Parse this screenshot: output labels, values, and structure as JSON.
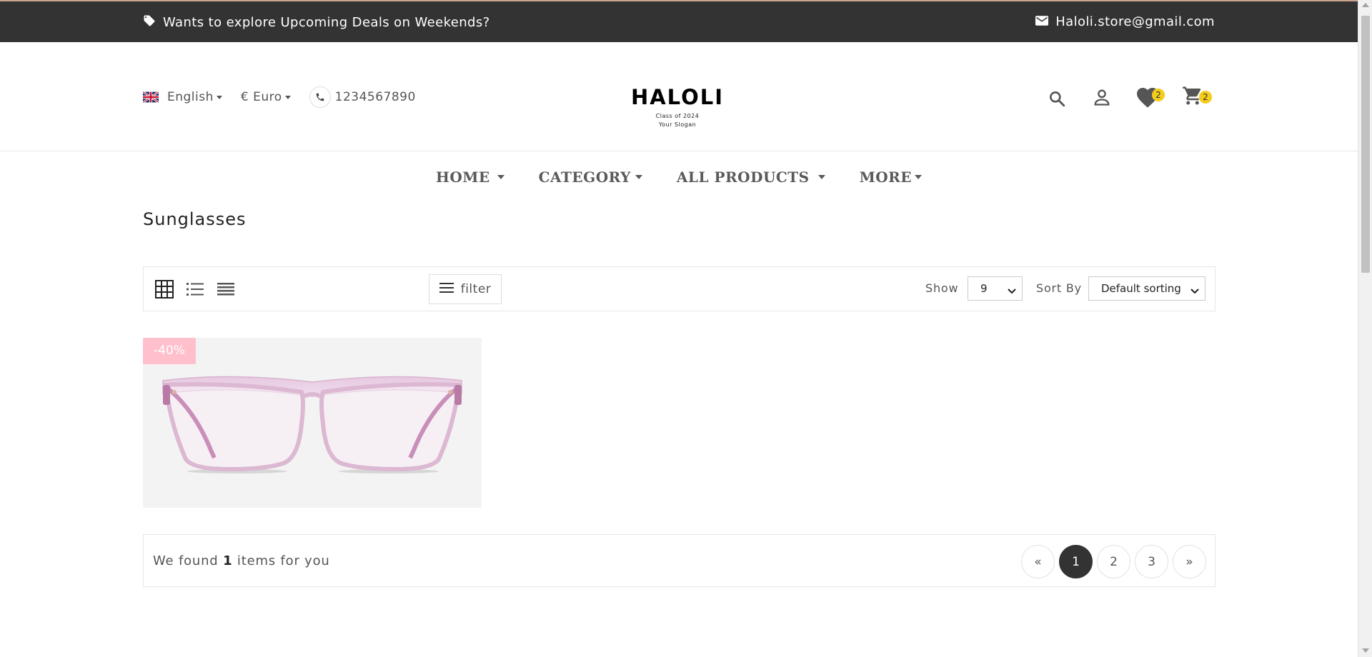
{
  "topbar": {
    "promo_text": "Wants to explore Upcoming Deals on Weekends?",
    "email": "Haloli.store@gmail.com"
  },
  "header": {
    "language": "English",
    "currency": "€ Euro",
    "phone": "1234567890",
    "logo_name": "HALOLI",
    "logo_line1": "Class of 2024",
    "logo_line2": "Your Slogan",
    "wishlist_count": "2",
    "cart_count": "2"
  },
  "nav": {
    "items": [
      {
        "label": "HOME"
      },
      {
        "label": "CATEGORY"
      },
      {
        "label": "ALL PRODUCTS"
      },
      {
        "label": "MORE"
      }
    ]
  },
  "page": {
    "title": "Sunglasses"
  },
  "toolbar": {
    "filter_label": "filter",
    "show_label": "Show",
    "show_value": "9",
    "sort_label": "Sort By",
    "sort_value": "Default sorting"
  },
  "product": {
    "discount": "-40%"
  },
  "results": {
    "prefix": "We found",
    "count": "1",
    "suffix": "items for you",
    "pages": {
      "prev": "«",
      "p1": "1",
      "p2": "2",
      "p3": "3",
      "next": "»"
    }
  },
  "colors": {
    "topbar_bg": "#333333",
    "badge": "#f4cc1c",
    "discount_bg": "#ffc0cc"
  }
}
